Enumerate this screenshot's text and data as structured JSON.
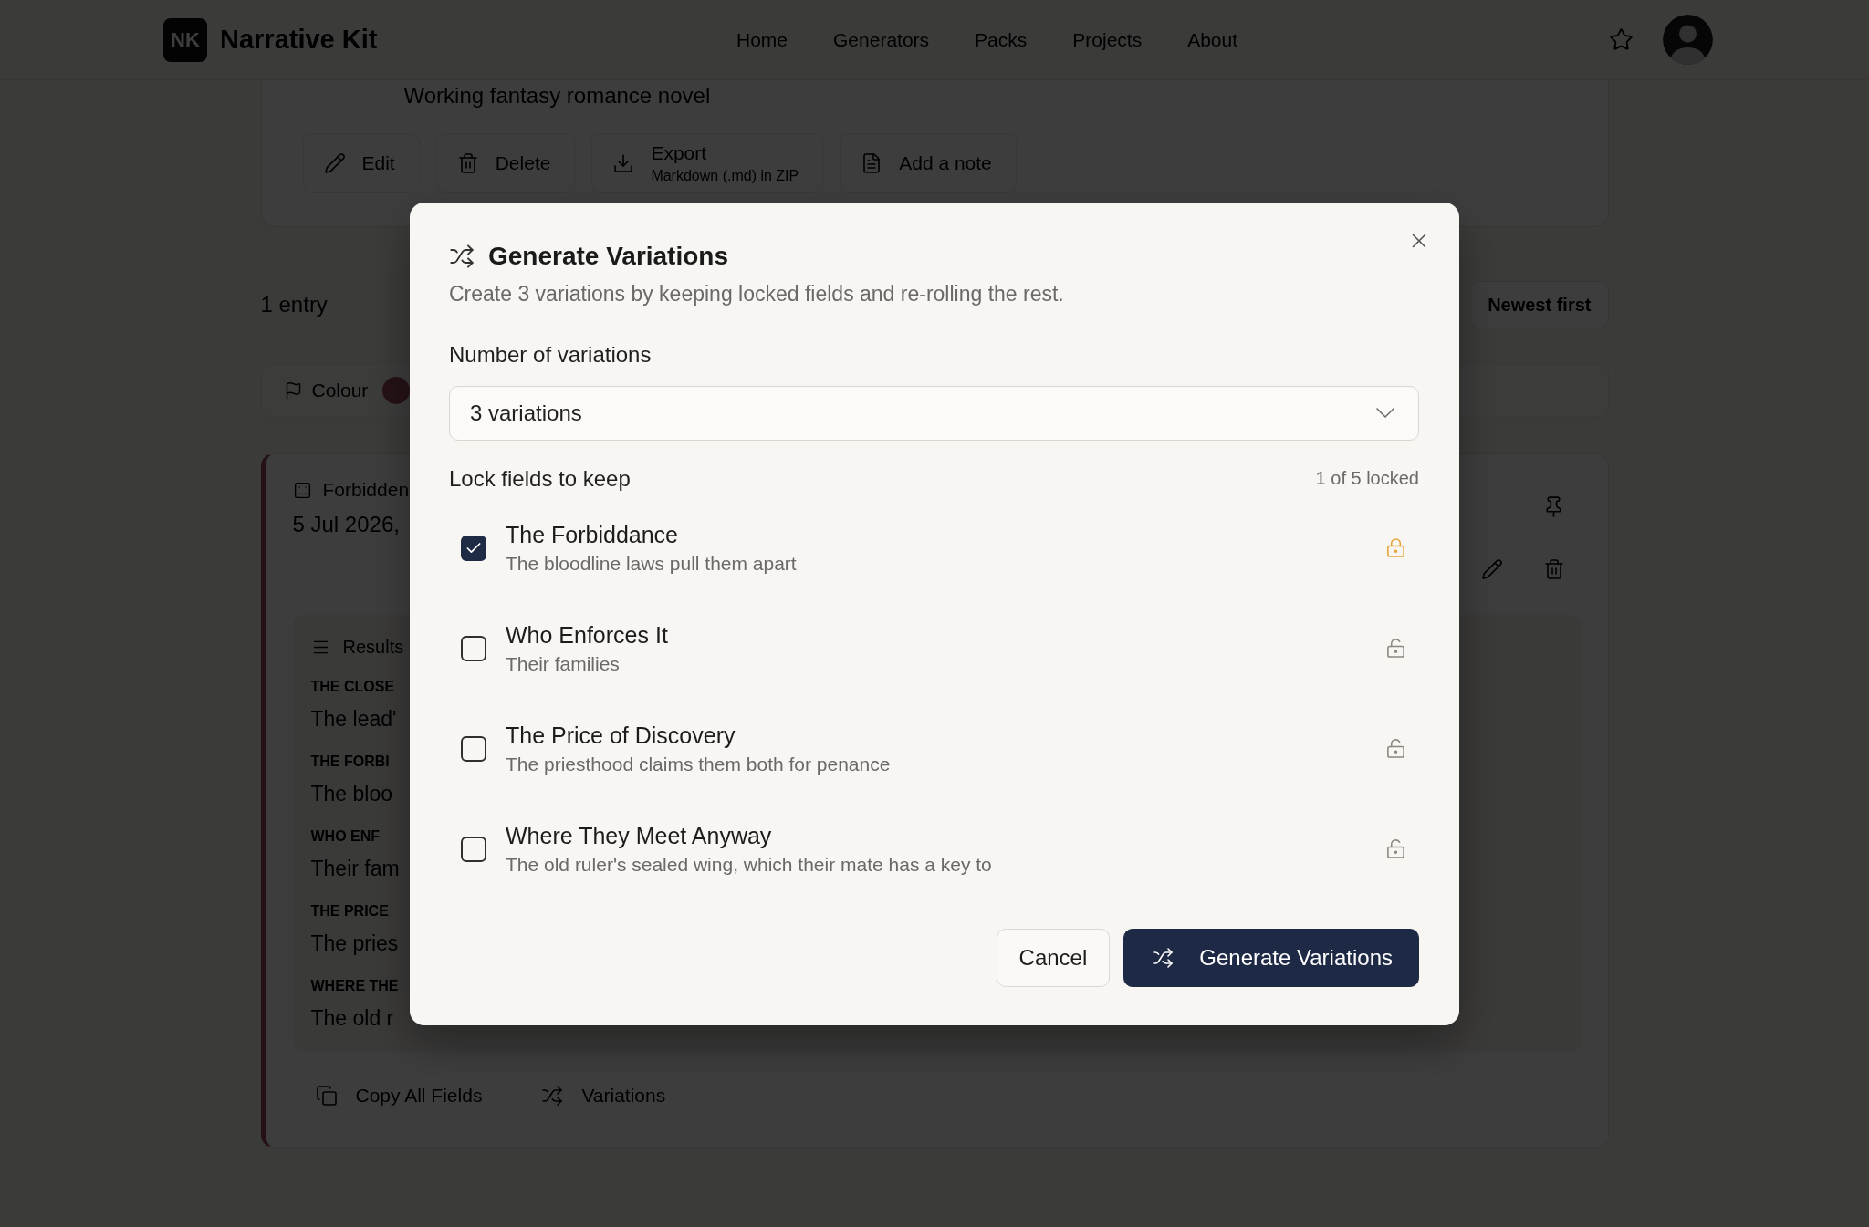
{
  "header": {
    "logo": "NK",
    "brand": "Narrative Kit",
    "nav": [
      {
        "label": "Home"
      },
      {
        "label": "Generators"
      },
      {
        "label": "Packs"
      },
      {
        "label": "Projects"
      },
      {
        "label": "About"
      }
    ]
  },
  "project": {
    "description": "Working fantasy romance novel",
    "actions": [
      {
        "kind": "edit",
        "label": "Edit"
      },
      {
        "kind": "delete",
        "label": "Delete"
      },
      {
        "kind": "export",
        "label": "Export",
        "detail": "Markdown (.md) in ZIP"
      },
      {
        "kind": "note",
        "label": "Add a note"
      }
    ]
  },
  "entries": {
    "count": "1 entry",
    "sort": "Newest first",
    "filter_label": "Colour"
  },
  "entry": {
    "title": "Forbidden",
    "date": "5 Jul 2026,",
    "results_label": "Results",
    "fields": [
      {
        "label": "THE CLOSE",
        "value": "The lead'"
      },
      {
        "label": "THE FORBI",
        "value": "The bloo"
      },
      {
        "label": "WHO ENF",
        "value": "Their fam"
      },
      {
        "label": "THE PRICE",
        "value": "The pries"
      },
      {
        "label": "WHERE THE",
        "value": "The old r"
      }
    ],
    "actions": [
      {
        "kind": "copy",
        "label": "Copy All Fields"
      },
      {
        "kind": "variations",
        "label": "Variations"
      }
    ]
  },
  "dialog": {
    "title": "Generate Variations",
    "description": "Create 3 variations by keeping locked fields and re-rolling the rest.",
    "count_label": "Number of variations",
    "count_value": "3 variations",
    "lock_label": "Lock fields to keep",
    "lock_summary": "1 of 5 locked",
    "fields": [
      {
        "title": "The Forbiddance",
        "value": "The bloodline laws pull them apart",
        "checked": true
      },
      {
        "title": "Who Enforces It",
        "value": "Their families",
        "checked": false
      },
      {
        "title": "The Price of Discovery",
        "value": "The priesthood claims them both for penance",
        "checked": false
      },
      {
        "title": "Where They Meet Anyway",
        "value": "The old ruler's sealed wing, which their mate has a key to",
        "checked": false
      }
    ],
    "buttons": [
      {
        "kind": "secondary",
        "label": "Cancel"
      },
      {
        "kind": "primary",
        "label": "Generate Variations"
      }
    ]
  }
}
